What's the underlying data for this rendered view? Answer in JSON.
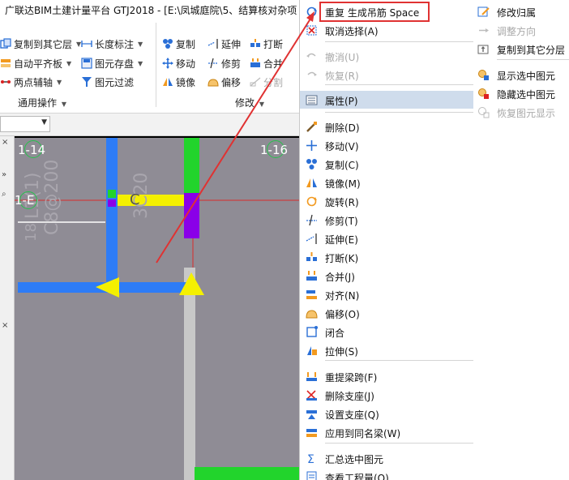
{
  "window": {
    "title": "广联达BIM土建计量平台 GTJ2018 - [E:\\凤城庭院\\5、结算核对杂项"
  },
  "ribbon": {
    "common_ops": {
      "copy_to_floor": "复制到其它层",
      "auto_align": "自动平齐板",
      "two_point_axis": "两点辅轴",
      "length_mark": "长度标注",
      "save_element": "图元存盘",
      "element_filter": "图元过滤",
      "group_label": "通用操作"
    },
    "modify": {
      "copy": "复制",
      "extend": "延伸",
      "break": "打断",
      "move": "移动",
      "trim": "修剪",
      "merge": "合并",
      "mirror": "镜像",
      "offset": "偏移",
      "split": "分割",
      "group_label": "修改"
    }
  },
  "canvas": {
    "axis_top_left": "1-14",
    "axis_top_right": "1-16",
    "axis_left": "1-E",
    "ghost_text_1": "L1(1)",
    "ghost_text_2": "C8@200",
    "ghost_text_3": "3C20",
    "ghost_text_4": "18",
    "beam_label": "C",
    "colors": {
      "background": "#8f8c95",
      "beam_blue": "#2e7cf6",
      "beam_yellow": "#f4f000",
      "beam_green": "#22d42c",
      "column_purple": "#8a00e8",
      "grid_red": "#d92b2b"
    }
  },
  "context_menu": {
    "items": [
      {
        "icon": "repeat-icon",
        "label": "重复 生成吊筋   Space",
        "disabled": false
      },
      {
        "icon": "cancel-select-icon",
        "label": "取消选择(A)",
        "disabled": false
      },
      {
        "icon": "undo-icon",
        "label": "撤消(U)",
        "disabled": true
      },
      {
        "icon": "redo-icon",
        "label": "恢复(R)",
        "disabled": true
      },
      {
        "icon": "properties-icon",
        "label": "属性(P)",
        "disabled": false,
        "highlighted": true
      },
      {
        "icon": "delete-icon",
        "label": "删除(D)",
        "disabled": false
      },
      {
        "icon": "move-icon",
        "label": "移动(V)",
        "disabled": false
      },
      {
        "icon": "copy-icon",
        "label": "复制(C)",
        "disabled": false
      },
      {
        "icon": "mirror-icon",
        "label": "镜像(M)",
        "disabled": false
      },
      {
        "icon": "rotate-icon",
        "label": "旋转(R)",
        "disabled": false
      },
      {
        "icon": "trim-icon",
        "label": "修剪(T)",
        "disabled": false
      },
      {
        "icon": "extend-icon",
        "label": "延伸(E)",
        "disabled": false
      },
      {
        "icon": "break-icon",
        "label": "打断(K)",
        "disabled": false
      },
      {
        "icon": "merge-icon",
        "label": "合并(J)",
        "disabled": false
      },
      {
        "icon": "align-icon",
        "label": "对齐(N)",
        "disabled": false
      },
      {
        "icon": "offset-icon",
        "label": "偏移(O)",
        "disabled": false
      },
      {
        "icon": "close-shape-icon",
        "label": "闭合",
        "disabled": false
      },
      {
        "icon": "stretch-icon",
        "label": "拉伸(S)",
        "disabled": false
      },
      {
        "icon": "reextract-span-icon",
        "label": "重提梁跨(F)",
        "disabled": false
      },
      {
        "icon": "delete-support-icon",
        "label": "删除支座(J)",
        "disabled": false
      },
      {
        "icon": "set-support-icon",
        "label": "设置支座(Q)",
        "disabled": false
      },
      {
        "icon": "apply-same-beam-icon",
        "label": "应用到同名梁(W)",
        "disabled": false
      },
      {
        "icon": "sum-selected-icon",
        "label": "汇总选中图元",
        "disabled": false
      },
      {
        "icon": "view-quantity-icon",
        "label": "查看工程量(Q)",
        "disabled": false
      }
    ]
  },
  "context_menu_right": {
    "items": [
      {
        "icon": "edit-attribution-icon",
        "label": "修改归属",
        "disabled": false
      },
      {
        "icon": "adjust-direction-icon",
        "label": "调整方向",
        "disabled": true
      },
      {
        "icon": "copy-to-layer-icon",
        "label": "复制到其它分层",
        "disabled": false
      },
      {
        "icon": "show-selected-icon",
        "label": "显示选中图元",
        "disabled": false
      },
      {
        "icon": "hide-selected-icon",
        "label": "隐藏选中图元",
        "disabled": false
      },
      {
        "icon": "restore-display-icon",
        "label": "恢复图元显示",
        "disabled": true
      }
    ]
  }
}
